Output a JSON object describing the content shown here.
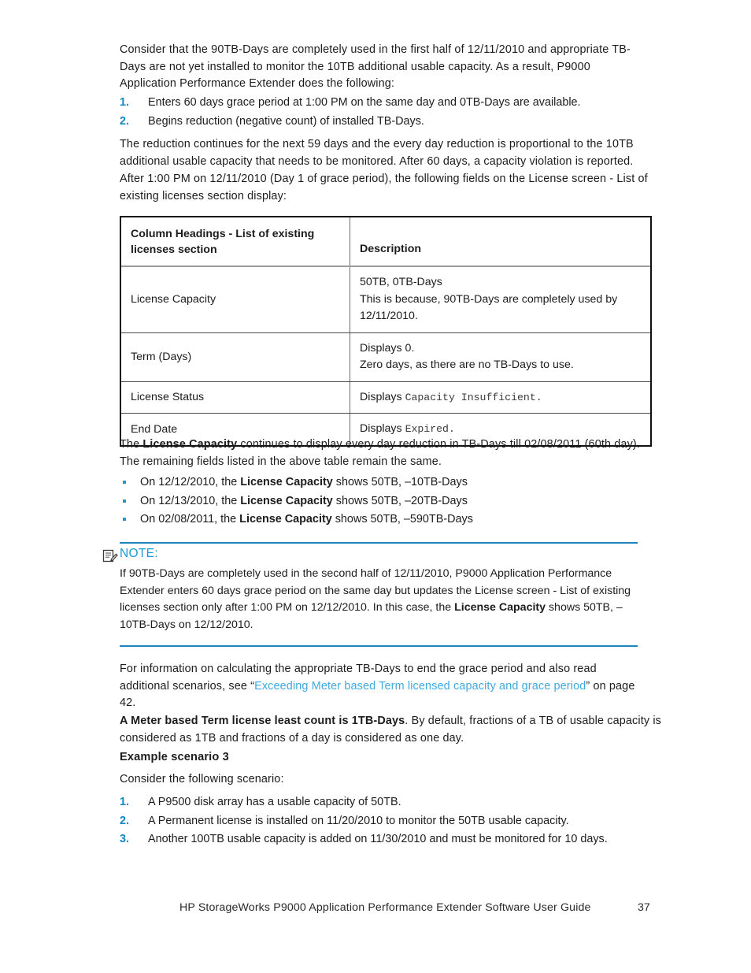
{
  "intro": {
    "paragraph": "Consider that the 90TB-Days are completely used in the first half of 12/11/2010 and appropriate TB-Days are not yet installed to monitor the 10TB additional usable capacity. As a result, P9000 Application Performance Extender does the following:"
  },
  "steps_top": [
    {
      "num": "1.",
      "text": "Enters 60 days grace period at 1:00 PM on the same day and 0TB-Days are available."
    },
    {
      "num": "2.",
      "text": "Begins reduction (negative count) of installed TB-Days."
    }
  ],
  "after_steps": {
    "paragraph_1": "The reduction continues for the next 59 days and the every day reduction is proportional to the 10TB additional usable capacity that needs to be monitored. After 60 days, a capacity violation is reported.",
    "paragraph_2": "After 1:00 PM on 12/11/2010 (Day 1 of grace period), the following fields on the License screen - List of existing licenses section display:"
  },
  "table": {
    "headers": {
      "col1": "Column Headings - List of existing licenses section",
      "col2": "Description"
    },
    "rows": [
      {
        "field": "License Capacity",
        "desc_line1": "50TB, 0TB-Days",
        "desc_line2": "This is because, 90TB-Days are completely used by 12/11/2010."
      },
      {
        "field": "Term (Days)",
        "desc_line1": "Displays 0.",
        "desc_line2": "Zero days, as there are no TB-Days to use."
      },
      {
        "field": "License Status",
        "desc_prefix": "Displays ",
        "desc_mono": "Capacity Insufficient",
        "desc_suffix": "."
      },
      {
        "field": "End Date",
        "desc_prefix": "Displays ",
        "desc_mono": "Expired",
        "desc_suffix": "."
      }
    ]
  },
  "post_table": {
    "lead_bold": "License Capacity",
    "lead_pre": "The ",
    "lead_post": " continues to display every day reduction in TB-Days till 02/08/2011 (60th day). The remaining fields listed in the above table remain the same."
  },
  "bullets": [
    {
      "pre": "On 12/12/2010, the ",
      "bold": "License Capacity",
      "post": " shows 50TB, –10TB-Days"
    },
    {
      "pre": "On 12/13/2010, the ",
      "bold": "License Capacity",
      "post": " shows 50TB, –20TB-Days"
    },
    {
      "pre": "On 02/08/2011, the ",
      "bold": "License Capacity",
      "post": " shows 50TB, –590TB-Days"
    }
  ],
  "note": {
    "icon": "note-pencil-icon",
    "label": "NOTE:",
    "body_pre": "If 90TB-Days are completely used in the second half of 12/11/2010, P9000 Application Performance Extender enters 60 days grace period on the same day but updates the License screen - List of existing licenses section only after 1:00 PM on 12/12/2010. In this case, the ",
    "body_bold": "License Capacity",
    "body_post": " shows 50TB, –10TB-Days on 12/12/2010.",
    "accent_color": "#1b9ad6",
    "rule_color": "#1b84b8"
  },
  "reference": {
    "pre": "For information on calculating the appropriate TB-Days to end the grace period and also read additional scenarios, see “",
    "link_text": "Exceeding Meter based Term licensed capacity and grace period",
    "post": "” on page 42.",
    "link_color": "#3fa9dd"
  },
  "least_count": {
    "bold": "A Meter based Term license least count is 1TB-Days",
    "rest": ". By default, fractions of a TB of usable capacity is considered as 1TB and fractions of a day is considered as one day."
  },
  "example": {
    "heading": "Example scenario 3",
    "lead": "Consider the following scenario:",
    "steps": [
      {
        "num": "1.",
        "text": "A P9500 disk array has a usable capacity of 50TB."
      },
      {
        "num": "2.",
        "text": "A Permanent license is installed on 11/20/2010 to monitor the 50TB usable capacity."
      },
      {
        "num": "3.",
        "text": "Another 100TB usable capacity is added on 11/30/2010 and must be monitored for 10 days."
      }
    ]
  },
  "footer": {
    "title": "HP StorageWorks P9000 Application Performance Extender Software User Guide",
    "page_number": "37"
  },
  "colors": {
    "list_number": "#0d87c6",
    "bullet": "#2196d4",
    "link": "#3fa9dd",
    "note_accent": "#1b9ad6"
  }
}
